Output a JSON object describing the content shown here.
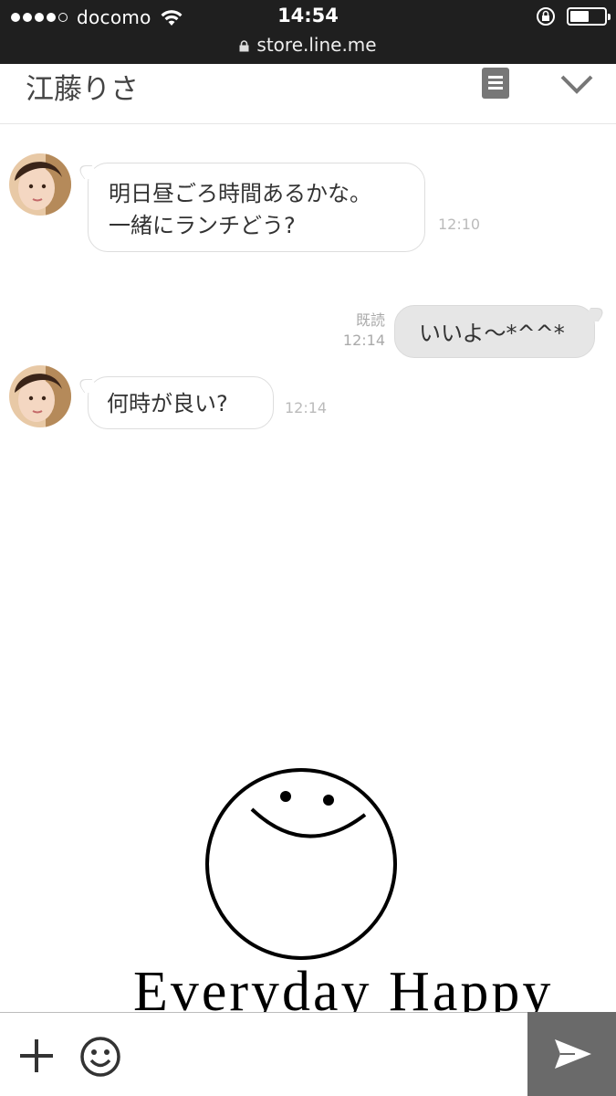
{
  "status_bar": {
    "carrier": "docomo",
    "time": "14:54",
    "url": "store.line.me",
    "battery_level": 0.55
  },
  "chat": {
    "title": "江藤りさ",
    "icons": {
      "menu": "note-icon",
      "collapse": "chevron-down-icon"
    }
  },
  "messages": [
    {
      "direction": "incoming",
      "text_lines": [
        "明日昼ごろ時間あるかな。",
        "一緒にランチどう?"
      ],
      "time": "12:10"
    },
    {
      "direction": "outgoing",
      "text": "いいよ〜*^^*",
      "read_label": "既読",
      "time": "12:14"
    },
    {
      "direction": "incoming",
      "text": "何時が良い?",
      "time": "12:14"
    }
  ],
  "background": {
    "caption": "Everyday Happy"
  },
  "input_bar": {
    "icons": {
      "add": "plus-icon",
      "sticker": "smiley-icon",
      "send": "send-icon"
    },
    "send_color": "#6a6a6a"
  }
}
